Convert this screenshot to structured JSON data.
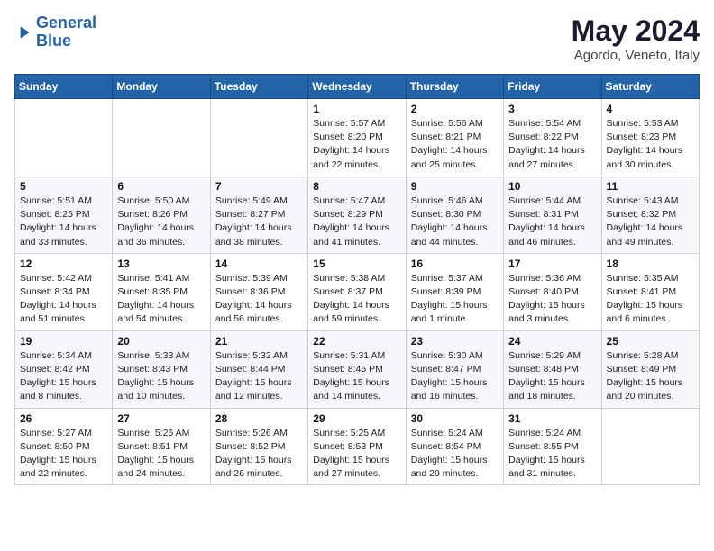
{
  "header": {
    "logo_line1": "General",
    "logo_line2": "Blue",
    "month": "May 2024",
    "location": "Agordo, Veneto, Italy"
  },
  "weekdays": [
    "Sunday",
    "Monday",
    "Tuesday",
    "Wednesday",
    "Thursday",
    "Friday",
    "Saturday"
  ],
  "weeks": [
    [
      {
        "day": "",
        "info": ""
      },
      {
        "day": "",
        "info": ""
      },
      {
        "day": "",
        "info": ""
      },
      {
        "day": "1",
        "info": "Sunrise: 5:57 AM\nSunset: 8:20 PM\nDaylight: 14 hours\nand 22 minutes."
      },
      {
        "day": "2",
        "info": "Sunrise: 5:56 AM\nSunset: 8:21 PM\nDaylight: 14 hours\nand 25 minutes."
      },
      {
        "day": "3",
        "info": "Sunrise: 5:54 AM\nSunset: 8:22 PM\nDaylight: 14 hours\nand 27 minutes."
      },
      {
        "day": "4",
        "info": "Sunrise: 5:53 AM\nSunset: 8:23 PM\nDaylight: 14 hours\nand 30 minutes."
      }
    ],
    [
      {
        "day": "5",
        "info": "Sunrise: 5:51 AM\nSunset: 8:25 PM\nDaylight: 14 hours\nand 33 minutes."
      },
      {
        "day": "6",
        "info": "Sunrise: 5:50 AM\nSunset: 8:26 PM\nDaylight: 14 hours\nand 36 minutes."
      },
      {
        "day": "7",
        "info": "Sunrise: 5:49 AM\nSunset: 8:27 PM\nDaylight: 14 hours\nand 38 minutes."
      },
      {
        "day": "8",
        "info": "Sunrise: 5:47 AM\nSunset: 8:29 PM\nDaylight: 14 hours\nand 41 minutes."
      },
      {
        "day": "9",
        "info": "Sunrise: 5:46 AM\nSunset: 8:30 PM\nDaylight: 14 hours\nand 44 minutes."
      },
      {
        "day": "10",
        "info": "Sunrise: 5:44 AM\nSunset: 8:31 PM\nDaylight: 14 hours\nand 46 minutes."
      },
      {
        "day": "11",
        "info": "Sunrise: 5:43 AM\nSunset: 8:32 PM\nDaylight: 14 hours\nand 49 minutes."
      }
    ],
    [
      {
        "day": "12",
        "info": "Sunrise: 5:42 AM\nSunset: 8:34 PM\nDaylight: 14 hours\nand 51 minutes."
      },
      {
        "day": "13",
        "info": "Sunrise: 5:41 AM\nSunset: 8:35 PM\nDaylight: 14 hours\nand 54 minutes."
      },
      {
        "day": "14",
        "info": "Sunrise: 5:39 AM\nSunset: 8:36 PM\nDaylight: 14 hours\nand 56 minutes."
      },
      {
        "day": "15",
        "info": "Sunrise: 5:38 AM\nSunset: 8:37 PM\nDaylight: 14 hours\nand 59 minutes."
      },
      {
        "day": "16",
        "info": "Sunrise: 5:37 AM\nSunset: 8:39 PM\nDaylight: 15 hours\nand 1 minute."
      },
      {
        "day": "17",
        "info": "Sunrise: 5:36 AM\nSunset: 8:40 PM\nDaylight: 15 hours\nand 3 minutes."
      },
      {
        "day": "18",
        "info": "Sunrise: 5:35 AM\nSunset: 8:41 PM\nDaylight: 15 hours\nand 6 minutes."
      }
    ],
    [
      {
        "day": "19",
        "info": "Sunrise: 5:34 AM\nSunset: 8:42 PM\nDaylight: 15 hours\nand 8 minutes."
      },
      {
        "day": "20",
        "info": "Sunrise: 5:33 AM\nSunset: 8:43 PM\nDaylight: 15 hours\nand 10 minutes."
      },
      {
        "day": "21",
        "info": "Sunrise: 5:32 AM\nSunset: 8:44 PM\nDaylight: 15 hours\nand 12 minutes."
      },
      {
        "day": "22",
        "info": "Sunrise: 5:31 AM\nSunset: 8:45 PM\nDaylight: 15 hours\nand 14 minutes."
      },
      {
        "day": "23",
        "info": "Sunrise: 5:30 AM\nSunset: 8:47 PM\nDaylight: 15 hours\nand 16 minutes."
      },
      {
        "day": "24",
        "info": "Sunrise: 5:29 AM\nSunset: 8:48 PM\nDaylight: 15 hours\nand 18 minutes."
      },
      {
        "day": "25",
        "info": "Sunrise: 5:28 AM\nSunset: 8:49 PM\nDaylight: 15 hours\nand 20 minutes."
      }
    ],
    [
      {
        "day": "26",
        "info": "Sunrise: 5:27 AM\nSunset: 8:50 PM\nDaylight: 15 hours\nand 22 minutes."
      },
      {
        "day": "27",
        "info": "Sunrise: 5:26 AM\nSunset: 8:51 PM\nDaylight: 15 hours\nand 24 minutes."
      },
      {
        "day": "28",
        "info": "Sunrise: 5:26 AM\nSunset: 8:52 PM\nDaylight: 15 hours\nand 26 minutes."
      },
      {
        "day": "29",
        "info": "Sunrise: 5:25 AM\nSunset: 8:53 PM\nDaylight: 15 hours\nand 27 minutes."
      },
      {
        "day": "30",
        "info": "Sunrise: 5:24 AM\nSunset: 8:54 PM\nDaylight: 15 hours\nand 29 minutes."
      },
      {
        "day": "31",
        "info": "Sunrise: 5:24 AM\nSunset: 8:55 PM\nDaylight: 15 hours\nand 31 minutes."
      },
      {
        "day": "",
        "info": ""
      }
    ]
  ]
}
